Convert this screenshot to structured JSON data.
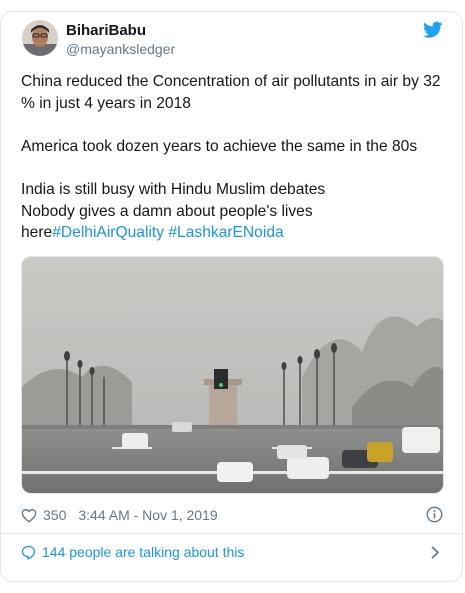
{
  "author": {
    "display_name": "BihariBabu",
    "handle": "@mayanksledger"
  },
  "tweet": {
    "paragraphs": [
      "China reduced the Concentration of air pollutants in air by 32 % in just 4 years in 2018",
      "America took dozen years to achieve the same in the 80s"
    ],
    "line_a": "India is still busy with Hindu Muslim debates",
    "line_b": "Nobody gives a damn about people's lives",
    "line_c_prefix": "here",
    "hashtag_1": "#DelhiAirQuality",
    "hashtag_2": "#LashkarENoida"
  },
  "footer": {
    "like_count": "350",
    "timestamp": "3:44 AM - Nov 1, 2019",
    "talking": "144 people are talking about this"
  },
  "icons": {
    "brand": "twitter-bird-icon",
    "like": "heart-icon",
    "info": "info-icon",
    "conversation": "speech-bubble-icon",
    "chevron": "chevron-right-icon"
  },
  "colors": {
    "accent": "#1da1f2",
    "link": "#1b95e0",
    "muted": "#657786",
    "border": "#e1e8ed"
  }
}
